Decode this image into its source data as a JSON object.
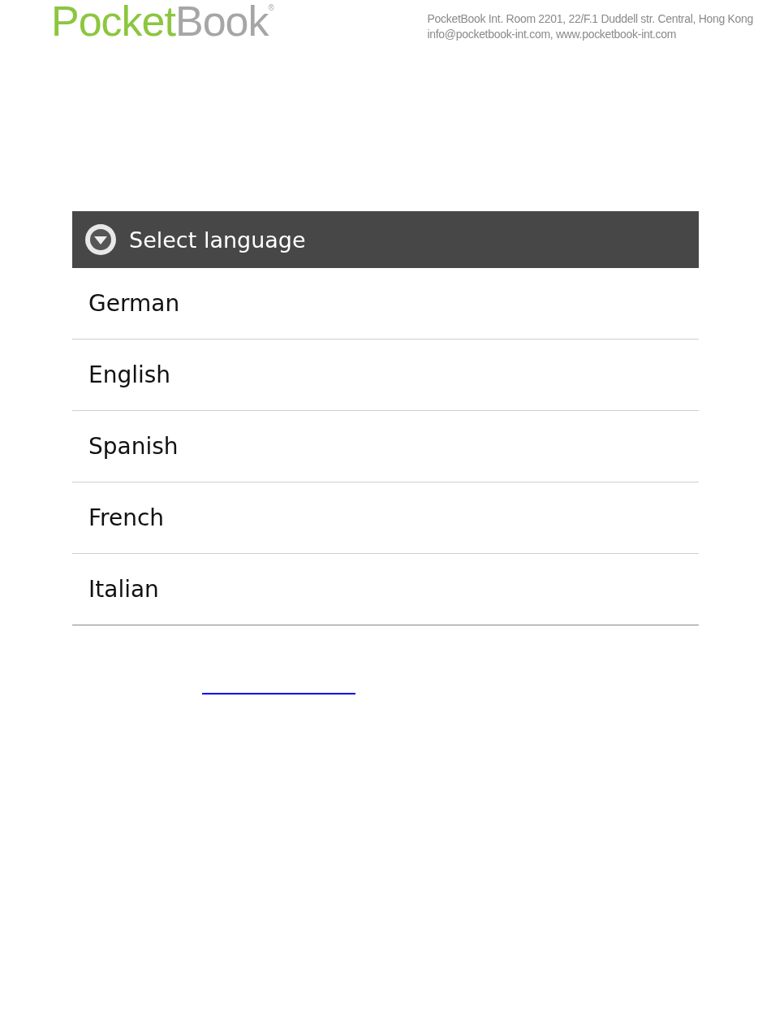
{
  "header": {
    "logo": {
      "part_1": "Pocket",
      "part_2": "Book",
      "mark": "®"
    },
    "address_lines": [
      "PocketBook Int. Room 2201, 22/F.1 Duddell str. Central, Hong Kong",
      "info@pocketbook-int.com, www.pocketbook-int.com"
    ]
  },
  "dialog": {
    "title": "Select language",
    "items": [
      {
        "label": "German"
      },
      {
        "label": "English"
      },
      {
        "label": "Spanish"
      },
      {
        "label": "French"
      },
      {
        "label": "Italian"
      }
    ]
  }
}
